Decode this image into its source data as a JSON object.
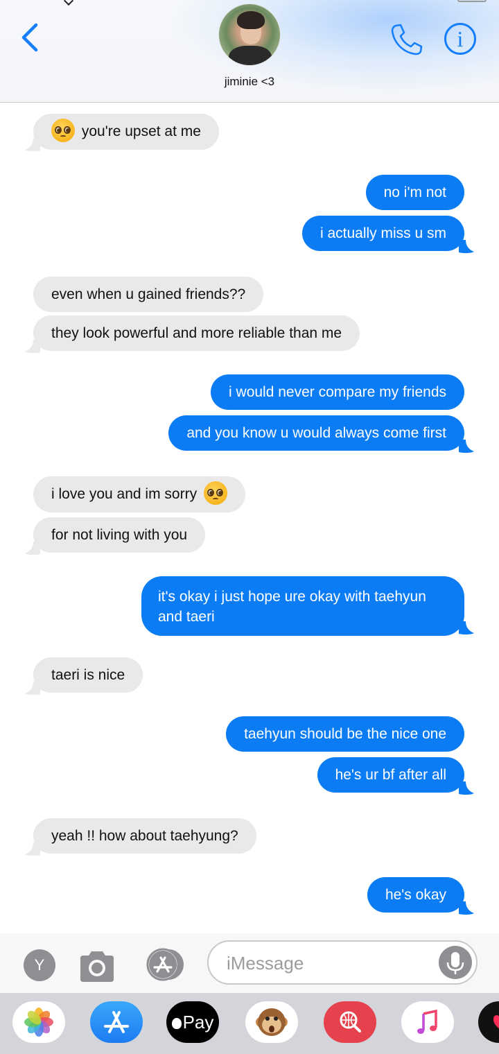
{
  "header": {
    "contact_name": "jiminie <3",
    "back_icon": "chevron-left-icon",
    "phone_icon": "phone-icon",
    "info_icon": "info-icon",
    "info_glyph": "i",
    "accent_color": "#157efb"
  },
  "messages": [
    {
      "side": "in",
      "text": "you're upset at me",
      "emoji": "pleading-face-icon"
    },
    {
      "side": "out",
      "text": "no i'm not"
    },
    {
      "side": "out",
      "text": "i actually miss u sm"
    },
    {
      "side": "in",
      "text": "even when u gained friends??"
    },
    {
      "side": "in",
      "text": "they look powerful and more reliable than me"
    },
    {
      "side": "out",
      "text": "i would never compare my friends"
    },
    {
      "side": "out",
      "text": "and you know u would always come first"
    },
    {
      "side": "in",
      "text": "i love you and im sorry",
      "emoji": "pleading-face-icon"
    },
    {
      "side": "in",
      "text": "for not living with you"
    },
    {
      "side": "out",
      "text_line1": "it's okay i just hope ure okay with taehyun",
      "text_line2": "and taeri"
    },
    {
      "side": "in",
      "text": "taeri is nice"
    },
    {
      "side": "out",
      "text": "taehyun should be the nice one"
    },
    {
      "side": "out",
      "text": "he's ur bf after all"
    },
    {
      "side": "in",
      "text": "yeah !! how about taehyung?"
    },
    {
      "side": "out",
      "text": "he's okay"
    }
  ],
  "input_bar": {
    "y_button_label": "Y",
    "camera_icon": "camera-icon",
    "appstore_icon": "app-store-icon",
    "placeholder": "iMessage",
    "mic_icon": "microphone-icon"
  },
  "app_drawer": {
    "apps": [
      {
        "name": "photos-app-icon"
      },
      {
        "name": "app-store-icon"
      },
      {
        "name": "apple-pay-icon",
        "label": "Pay"
      },
      {
        "name": "animoji-monkey-icon"
      },
      {
        "name": "web-search-icon"
      },
      {
        "name": "music-icon"
      },
      {
        "name": "digital-touch-icon"
      }
    ]
  },
  "colors": {
    "incoming_bubble": "#e9e9eb",
    "outgoing_bubble": "#0b7cf4"
  }
}
